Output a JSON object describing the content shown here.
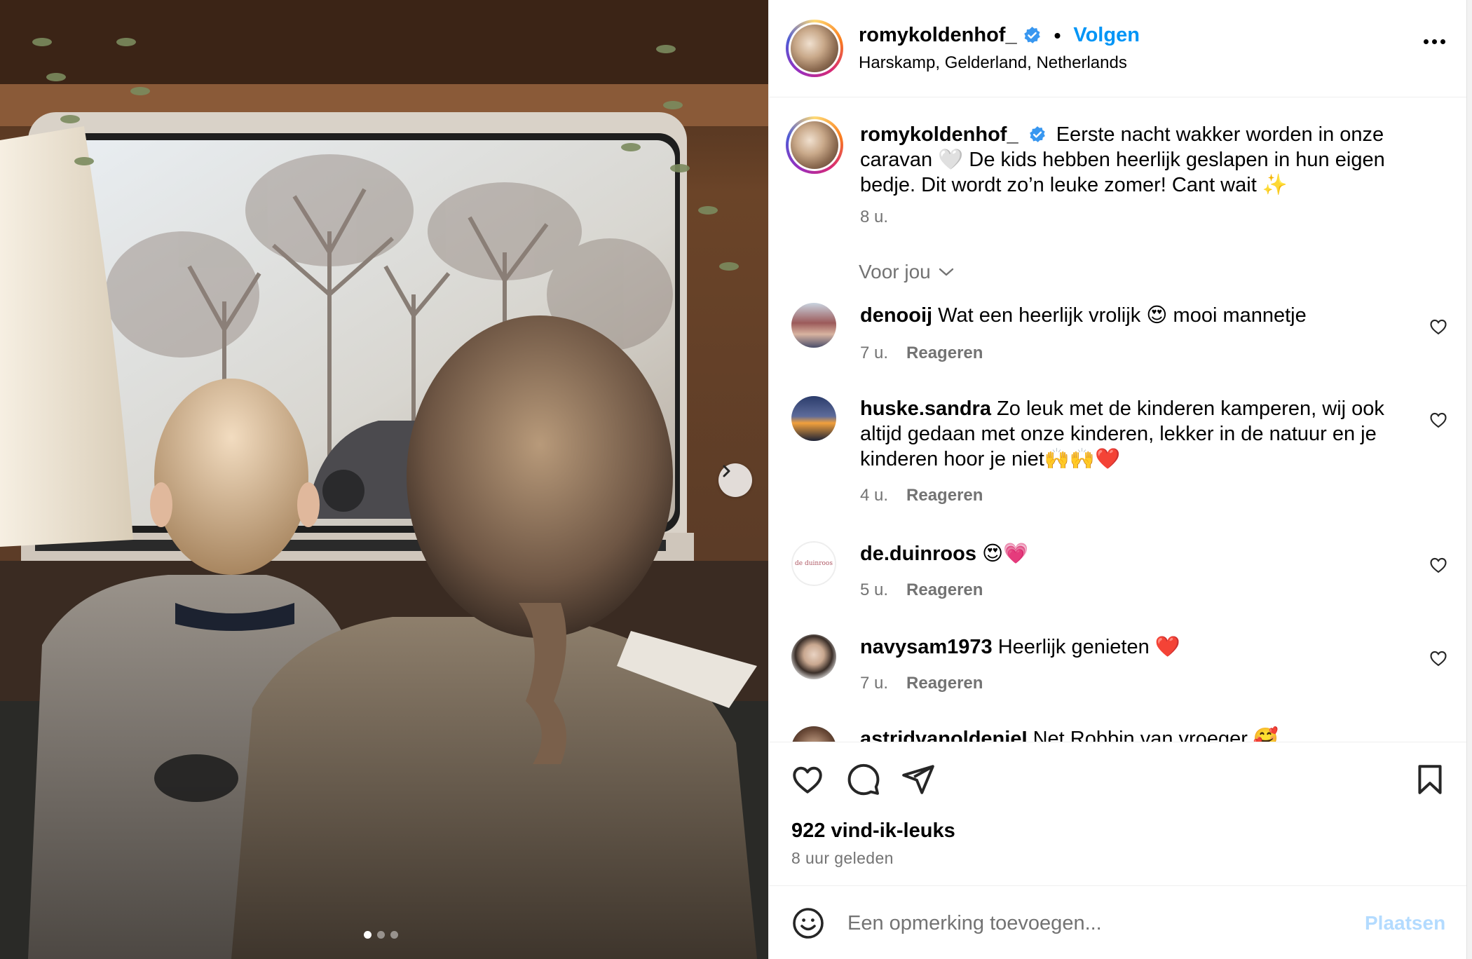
{
  "post": {
    "username": "romykoldenhof_",
    "follow_label": "Volgen",
    "location": "Harskamp, Gelderland, Netherlands",
    "caption_text": "Eerste nacht wakker worden in onze caravan 🤍 De kids hebben heerlijk geslapen in hun eigen bedje. Dit wordt zo’n leuke zomer! Cant wait ✨",
    "caption_time": "8 u.",
    "for_you_label": "Voor jou",
    "carousel": {
      "total": 3,
      "active": 0
    },
    "likes_text": "922 vind-ik-leuks",
    "posted_ago": "8 uur geleden"
  },
  "comments": [
    {
      "username": "denooij",
      "text": "Wat een heerlijk vrolijk 😍 mooi mannetje",
      "time": "7 u.",
      "reply_label": "Reageren"
    },
    {
      "username": "huske.sandra",
      "text": "Zo leuk met de kinderen kamperen, wij ook altijd gedaan met onze kinderen, lekker in de natuur en je kinderen hoor je niet🙌🙌❤️",
      "time": "4 u.",
      "reply_label": "Reageren"
    },
    {
      "username": "de.duinroos",
      "text": "😍💗",
      "time": "5 u.",
      "reply_label": "Reageren",
      "avatar_text": "de duinroos"
    },
    {
      "username": "navysam1973",
      "text": "Heerlijk genieten ❤️",
      "time": "7 u.",
      "reply_label": "Reageren"
    },
    {
      "username": "astridvanoldenieI",
      "text": "Net Robbin van vroeger 🥰"
    }
  ],
  "composer": {
    "placeholder": "Een opmerking toevoegen...",
    "post_label": "Plaatsen"
  },
  "colors": {
    "accent": "#0095f6",
    "muted": "#737373",
    "post_disabled": "#b3dbff"
  }
}
